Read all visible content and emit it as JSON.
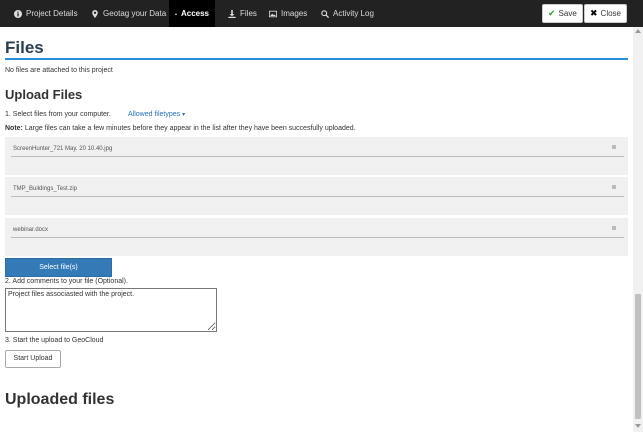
{
  "nav": {
    "tabs": [
      {
        "label": "Project Details",
        "icon": "info-icon"
      },
      {
        "label": "Geotag your Data",
        "icon": "map-marker-icon"
      },
      {
        "label": "Access",
        "icon": "lock-icon"
      },
      {
        "label": "Files",
        "icon": "download-icon"
      },
      {
        "label": "Images",
        "icon": "image-icon"
      },
      {
        "label": "Activity Log",
        "icon": "search-icon"
      }
    ],
    "save_label": "Save",
    "close_label": "Close"
  },
  "files_section": {
    "title": "Files",
    "empty_text": "No files are attached to this project"
  },
  "upload": {
    "title": "Upload Files",
    "step1": "1. Select files from your computer.",
    "allowed_filetypes": "Allowed filetypes",
    "note_label": "Note:",
    "note_text": " Large files can take a few minutes before they appear in the list after they have been succesfully uploaded.",
    "files": [
      {
        "name": "ScreenHunter_721 May. 20 10.40.jpg"
      },
      {
        "name": "TMP_Buildings_Test.zip"
      },
      {
        "name": "webinar.docx"
      }
    ],
    "select_button": "Select file(s)",
    "step2": "2. Add comments to your file (Optional).",
    "comment_value": "Project files associasted with the project.",
    "step3": "3. Start the upload to GeoCloud",
    "start_button": "Start Upload"
  },
  "uploaded": {
    "title": "Uploaded files"
  }
}
